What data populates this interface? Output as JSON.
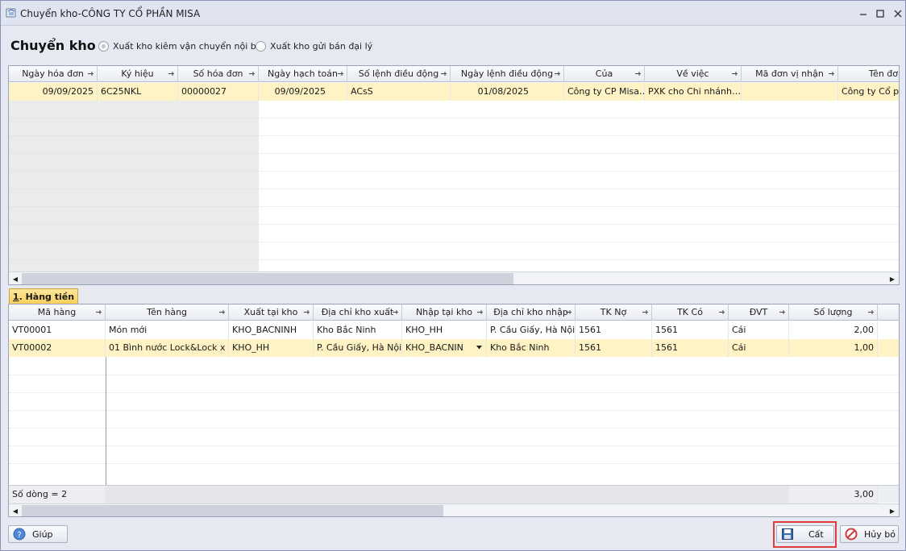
{
  "window": {
    "title": "Chuyển kho-CÔNG TY CỔ PHẦN MISA"
  },
  "header": {
    "title": "Chuyển kho",
    "radio_internal": "Xuất kho kiêm vận chuyển nội bộ",
    "radio_agent": "Xuất kho gửi bán đại lý"
  },
  "top_grid": {
    "columns": [
      "Ngày hóa đơn",
      "Ký hiệu",
      "Số hóa đơn",
      "Ngày hạch toán",
      "Số lệnh điều động",
      "Ngày lệnh điều động",
      "Của",
      "Về việc",
      "Mã đơn vị nhận",
      "Tên đơ"
    ],
    "row": [
      "09/09/2025",
      "6C25NKL",
      "00000027",
      "09/09/2025",
      "ACsS",
      "01/08/2025",
      "Công ty CP Misa…",
      "PXK cho Chi nhánh…",
      "",
      "Công ty Cổ phầ"
    ]
  },
  "tab": {
    "number": "1",
    "label": ". Hàng tiền"
  },
  "bottom_grid": {
    "columns": [
      "Mã hàng",
      "Tên hàng",
      "Xuất tại kho",
      "Địa chỉ kho xuất",
      "Nhập tại kho",
      "Địa chỉ kho nhập",
      "TK Nợ",
      "TK Có",
      "ĐVT",
      "Số lượng"
    ],
    "rows": [
      [
        "VT00001",
        "Món mới",
        "KHO_BACNINH",
        "Kho Bắc Ninh",
        "KHO_HH",
        "P. Cầu Giấy, Hà Nội",
        "1561",
        "1561",
        "Cái",
        "2,00"
      ],
      [
        "VT00002",
        "01 Bình nước Lock&Lock x",
        "KHO_HH",
        "P. Cầu Giấy, Hà Nội",
        "KHO_BACNIN",
        "Kho Bắc Ninh",
        "1561",
        "1561",
        "Cái",
        "1,00"
      ]
    ],
    "footer_count": "Số dòng = 2",
    "footer_total": "3,00"
  },
  "buttons": {
    "help": "Giúp",
    "save": "Cất",
    "cancel": "Hủy bỏ"
  }
}
